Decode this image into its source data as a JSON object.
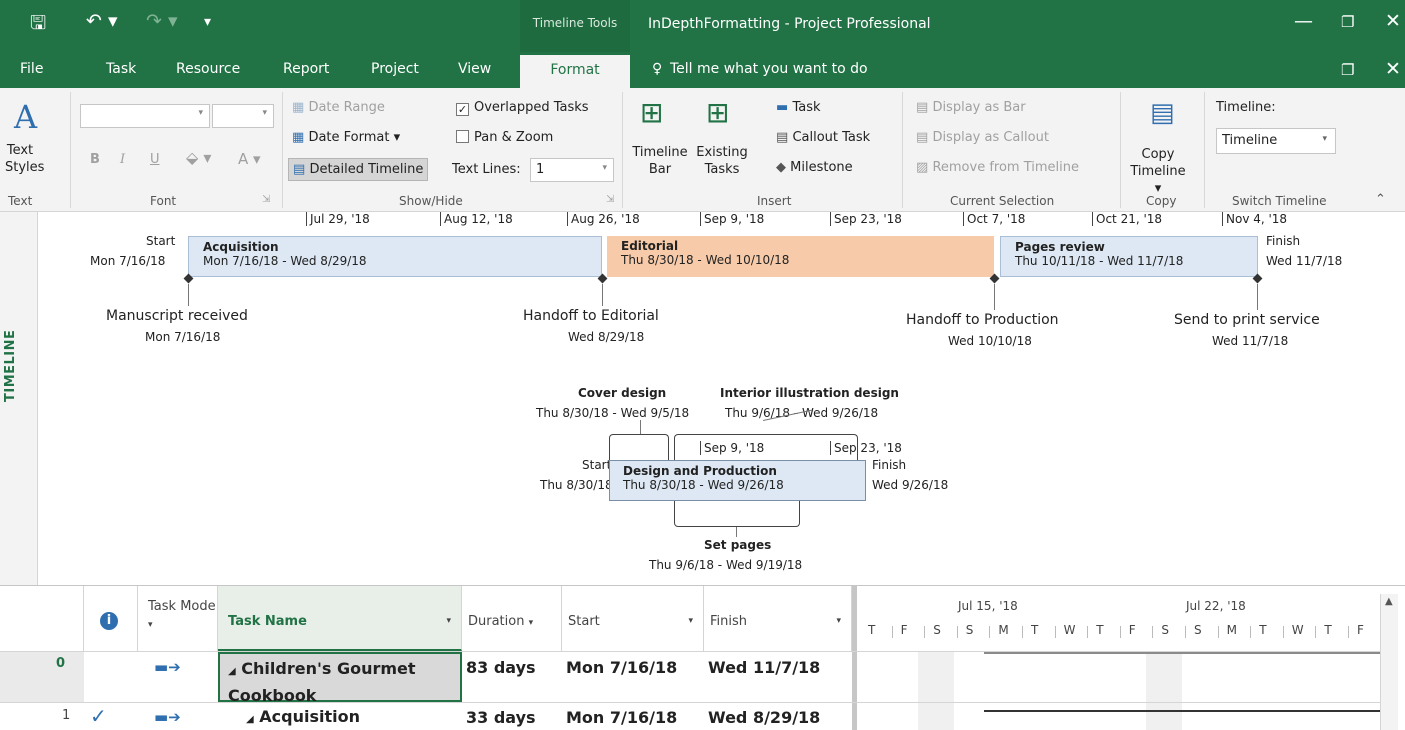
{
  "title_bar": {
    "context_tab_group": "Timeline Tools",
    "app_title": "InDepthFormatting - Project Professional"
  },
  "menu": {
    "tabs": [
      "File",
      "Task",
      "Resource",
      "Report",
      "Project",
      "View",
      "Format"
    ],
    "active_tab": "Format",
    "tell_me": "Tell me what you want to do"
  },
  "ribbon": {
    "text_group": {
      "text_styles": "Text Styles",
      "label": "Text"
    },
    "font_group": {
      "bold": "B",
      "italic": "I",
      "underline": "U",
      "font_color": "A",
      "label": "Font"
    },
    "show_hide_group": {
      "date_range": "Date Range",
      "date_format": "Date Format",
      "detailed_timeline": "Detailed Timeline",
      "overlapped_tasks": "Overlapped Tasks",
      "overlapped_checked": true,
      "pan_zoom": "Pan & Zoom",
      "pan_zoom_checked": false,
      "text_lines_label": "Text Lines:",
      "text_lines_value": "1",
      "label": "Show/Hide"
    },
    "insert_group": {
      "timeline_bar": "Timeline Bar",
      "existing_tasks": "Existing Tasks",
      "task": "Task",
      "callout_task": "Callout Task",
      "milestone": "Milestone",
      "label": "Insert"
    },
    "current_selection_group": {
      "display_as_bar": "Display as Bar",
      "display_as_callout": "Display as Callout",
      "remove_from_timeline": "Remove from Timeline",
      "label": "Current Selection"
    },
    "copy_group": {
      "copy_timeline": "Copy Timeline",
      "label": "Copy"
    },
    "switch_timeline_group": {
      "timeline_label": "Timeline:",
      "timeline_value": "Timeline",
      "label": "Switch Timeline"
    }
  },
  "timeline": {
    "side_label": "TIMELINE",
    "scale_ticks": [
      "Jul 29, '18",
      "Aug 12, '18",
      "Aug 26, '18",
      "Sep 9, '18",
      "Sep 23, '18",
      "Oct 7, '18",
      "Oct 21, '18",
      "Nov 4, '18"
    ],
    "start": {
      "label": "Start",
      "date": "Mon 7/16/18"
    },
    "finish": {
      "label": "Finish",
      "date": "Wed 11/7/18"
    },
    "bars": [
      {
        "name": "Acquisition",
        "dates": "Mon 7/16/18 - Wed 8/29/18",
        "color": "#dde8f4"
      },
      {
        "name": "Editorial",
        "dates": "Thu 8/30/18 - Wed 10/10/18",
        "color": "#f7cbaa"
      },
      {
        "name": "Pages review",
        "dates": "Thu 10/11/18 - Wed 11/7/18",
        "color": "#dde8f4"
      }
    ],
    "milestones": [
      {
        "name": "Manuscript received",
        "date": "Mon 7/16/18"
      },
      {
        "name": "Handoff to Editorial",
        "date": "Wed 8/29/18"
      },
      {
        "name": "Handoff to Production",
        "date": "Wed 10/10/18"
      },
      {
        "name": "Send to print service",
        "date": "Wed 11/7/18"
      }
    ],
    "sub": {
      "scale_ticks": [
        "Sep 9, '18",
        "Sep 23, '18"
      ],
      "start": {
        "label": "Start",
        "date": "Thu 8/30/18"
      },
      "finish": {
        "label": "Finish",
        "date": "Wed 9/26/18"
      },
      "bar": {
        "name": "Design and Production",
        "dates": "Thu 8/30/18 - Wed 9/26/18"
      },
      "callouts": [
        {
          "name": "Cover design",
          "dates": "Thu 8/30/18 - Wed 9/5/18"
        },
        {
          "name": "Interior illustration design",
          "dates": "Thu 9/6/18 - Wed 9/26/18"
        },
        {
          "name": "Set pages",
          "dates": "Thu 9/6/18 - Wed 9/19/18"
        }
      ]
    }
  },
  "grid": {
    "headers": {
      "info": "i",
      "task_mode": "Task Mode",
      "task_name": "Task Name",
      "duration": "Duration",
      "start": "Start",
      "finish": "Finish"
    },
    "gantt_weeks": [
      "Jul 15, '18",
      "Jul 22, '18"
    ],
    "gantt_days": [
      "T",
      "F",
      "S",
      "S",
      "M",
      "T",
      "W",
      "T",
      "F",
      "S",
      "S",
      "M",
      "T",
      "W",
      "T",
      "F"
    ],
    "rows": [
      {
        "id": "0",
        "check": "",
        "name": "Children's Gourmet Cookbook",
        "duration": "83 days",
        "start": "Mon 7/16/18",
        "finish": "Wed 11/7/18"
      },
      {
        "id": "1",
        "check": "✓",
        "name": "Acquisition",
        "duration": "33 days",
        "start": "Mon 7/16/18",
        "finish": "Wed 8/29/18"
      }
    ]
  }
}
